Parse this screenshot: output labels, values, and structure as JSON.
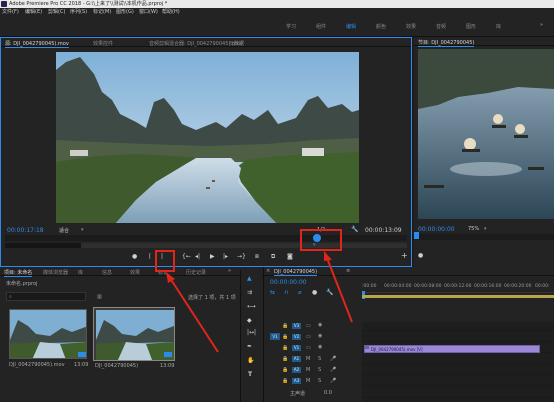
{
  "window": {
    "title": "Adobe Premiere Pro CC 2018 - G:\\\\上来了\\\\测试\\\\本机作品.prproj *"
  },
  "menu": [
    "文件(F)",
    "编辑(E)",
    "剪辑(C)",
    "序列(S)",
    "标记(M)",
    "图形(G)",
    "窗口(W)",
    "帮助(H)"
  ],
  "workspaces": [
    "学习",
    "组件",
    "编辑",
    "颜色",
    "效果",
    "音频",
    "图形",
    "库"
  ],
  "source": {
    "tabs": [
      "源: DJI_0042790045).mov",
      "效果控件",
      "音频剪辑混合器: DJI_0042790045).mov",
      "元数据"
    ],
    "timecode": "00:00:17:18",
    "fit": "适合",
    "scale": "1/2",
    "duration": "00:00:13:09"
  },
  "program": {
    "tab": "节目: DJI_0042790045)",
    "timecode": "00:00:00:00",
    "fit": "75%"
  },
  "project": {
    "tabs": [
      "项目: 未命名",
      "媒体浏览器",
      "库",
      "信息",
      "效果",
      "标记",
      "历史记录"
    ],
    "file": "未命名.prproj",
    "selection": "选择了 1 项，共 1 项",
    "clips": [
      {
        "name": "DJI_0042790045).mov",
        "duration": "13:09"
      },
      {
        "name": "DJI_0042790045)",
        "duration": "13:09"
      }
    ]
  },
  "timeline": {
    "tab": "DJI_0042790045)",
    "timecode": "00:00:00:00",
    "ruler": [
      ":00:00",
      "00:00:04:00",
      "00:00:08:00",
      "00:00:12:00",
      "00:00:16:00",
      "00:00:20:00",
      "00:00:"
    ],
    "tracks": [
      "V3",
      "V2",
      "V1",
      "A1",
      "A2",
      "A3"
    ],
    "master": "主声道",
    "master_value": "0.0",
    "clip_label": "DJI_0042790045).mov [V]"
  },
  "colors": {
    "accent": "#2d8ceb",
    "clip": "#9c86d6",
    "annotation": "#e0261b"
  }
}
